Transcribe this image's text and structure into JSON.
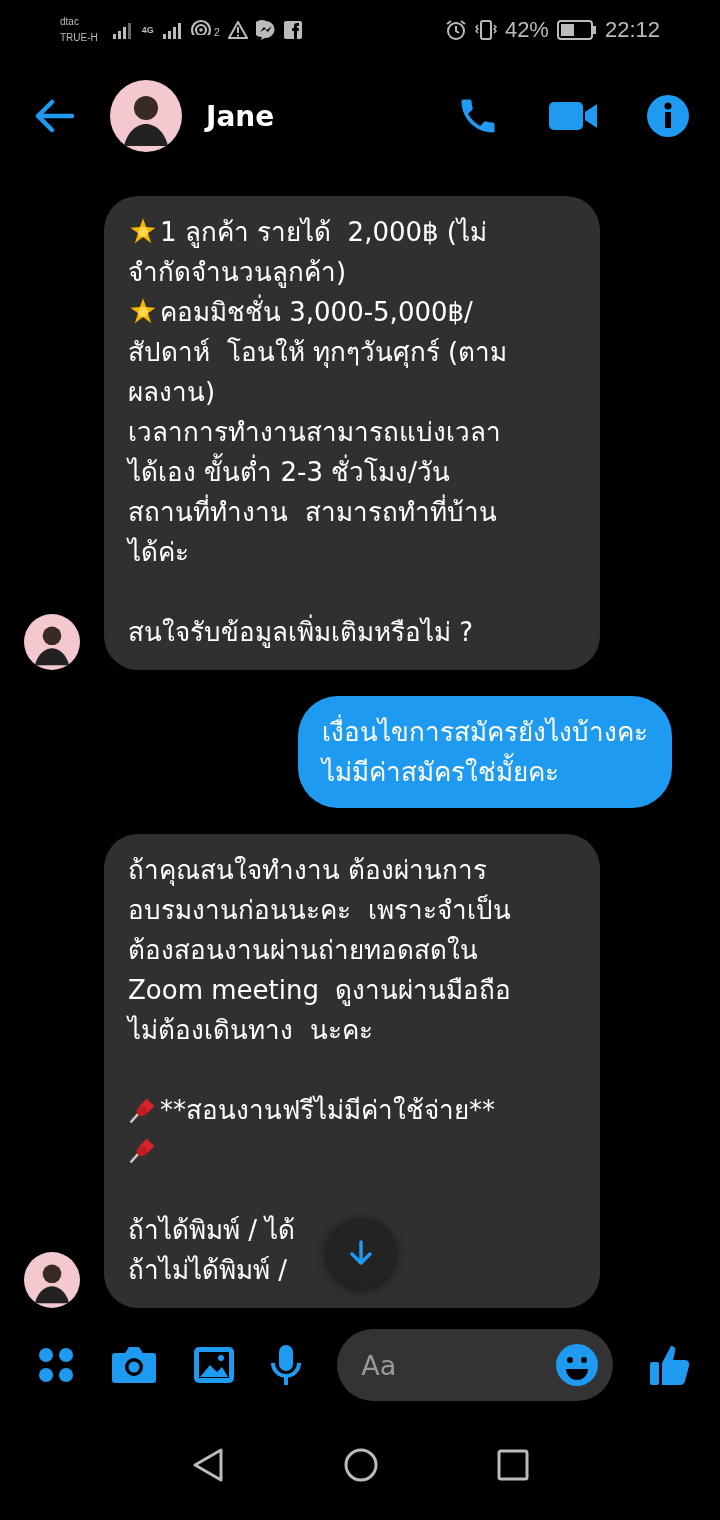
{
  "status_bar": {
    "carrier_1": "dtac",
    "carrier_2": "TRUE-H",
    "network": "4G",
    "hotspot_count": "2",
    "battery": "42%",
    "time": "22:12"
  },
  "header": {
    "name": "Jane"
  },
  "messages": [
    {
      "kind": "incoming",
      "lines": [
        {
          "kind": "star",
          "text": "1 ลูกค้า รายได้  2,000฿ (ไม่"
        },
        {
          "kind": "text",
          "text": "จำกัดจำนวนลูกค้า)"
        },
        {
          "kind": "star",
          "text": "คอมมิชชั่น 3,000-5,000฿/"
        },
        {
          "kind": "text",
          "text": "สัปดาห์  โอนให้ ทุกๆวันศุกร์ (ตาม"
        },
        {
          "kind": "text",
          "text": "ผลงาน)"
        },
        {
          "kind": "text",
          "text": "เวลาการทำงานสามารถแบ่งเวลา"
        },
        {
          "kind": "text",
          "text": "ได้เอง ขั้นต่ำ 2-3 ชั่วโมง/วัน"
        },
        {
          "kind": "text",
          "text": "สถานที่ทำงาน  สามารถทำที่บ้าน"
        },
        {
          "kind": "text",
          "text": "ได้ค่ะ"
        },
        {
          "kind": "blank"
        },
        {
          "kind": "text",
          "text": "สนใจรับข้อมูลเพิ่มเติมหรือไม่ ?"
        }
      ]
    },
    {
      "kind": "outgoing",
      "lines": [
        {
          "kind": "text",
          "text": "เงื่อนไขการสมัครยังไงบ้างคะ"
        },
        {
          "kind": "text",
          "text": "ไม่มีค่าสมัครใช่มั้ยคะ"
        }
      ]
    },
    {
      "kind": "incoming",
      "lines": [
        {
          "kind": "text",
          "text": "ถ้าคุณสนใจทำงาน ต้องผ่านการ"
        },
        {
          "kind": "text",
          "text": "อบรมงานก่อนนะคะ  เพราะจำเป็น"
        },
        {
          "kind": "text",
          "text": "ต้องสอนงานผ่านถ่ายทอดสดใน"
        },
        {
          "kind": "text",
          "text": "Zoom meeting  ดูงานผ่านมือถือ"
        },
        {
          "kind": "text",
          "text": "ไม่ต้องเดินทาง  นะคะ"
        },
        {
          "kind": "blank"
        },
        {
          "kind": "pin",
          "text": "**สอนงานฟรีไม่มีค่าใช้จ่าย**"
        },
        {
          "kind": "pin"
        },
        {
          "kind": "blank"
        },
        {
          "kind": "text",
          "text": "ถ้าได้พิมพ์ / ได้"
        },
        {
          "kind": "text",
          "text": "ถ้าไม่ได้พิมพ์ /"
        }
      ]
    }
  ],
  "composer": {
    "placeholder": "Aa"
  }
}
